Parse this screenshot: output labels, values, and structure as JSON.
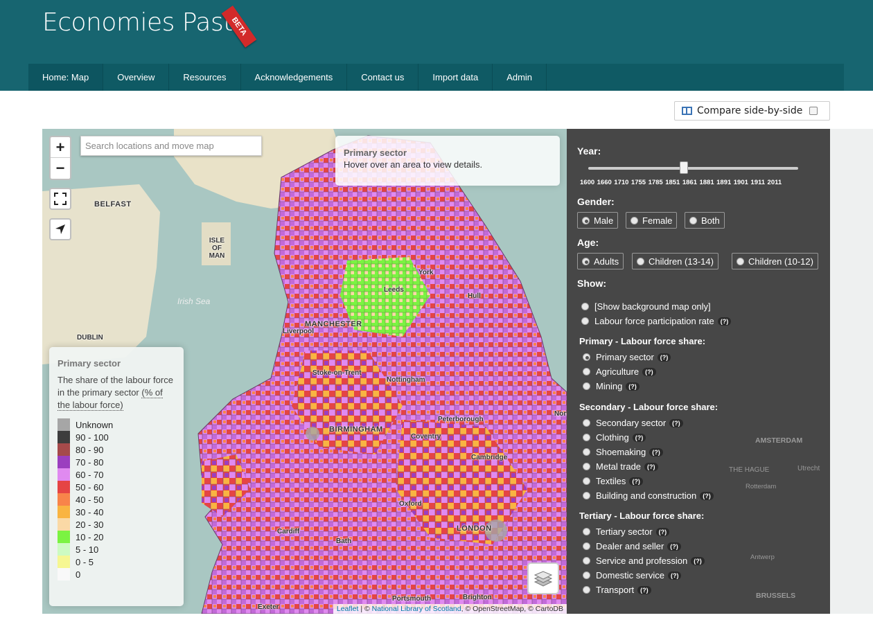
{
  "brand": {
    "title": "Economies Past",
    "badge": "BETA"
  },
  "nav": [
    "Home: Map",
    "Overview",
    "Resources",
    "Acknowledgements",
    "Contact us",
    "Import data",
    "Admin"
  ],
  "compare": {
    "label": "Compare side-by-side",
    "checked": false
  },
  "map": {
    "zoom_in": "+",
    "zoom_out": "−",
    "search_placeholder": "Search locations and move map",
    "info": {
      "title": "Primary sector",
      "text": "Hover over an area to view details."
    },
    "places": [
      "BELFAST",
      "ISLE OF MAN",
      "Irish Sea",
      "DUBLIN",
      "York",
      "Leeds",
      "Hull",
      "MANCHESTER",
      "Liverpool",
      "Stoke-on-Trent",
      "Nottingham",
      "Peterborough",
      "BIRMINGHAM",
      "Coventry",
      "Cambridge",
      "Oxford",
      "Cardiff",
      "Bath",
      "LONDON",
      "Portsmouth",
      "Brighton",
      "Exeter",
      "Norwich"
    ],
    "attribution": {
      "leaflet": "Leaflet",
      "nls": "National Library of Scotland",
      "rest": "© OpenStreetMap, © CartoDB"
    }
  },
  "legend": {
    "title": "Primary sector",
    "description": "The share of the labour force in the primary sector",
    "unit": "(% of the labour force)",
    "items": [
      {
        "label": "Unknown",
        "color": "#a6a6a6"
      },
      {
        "label": "90 - 100",
        "color": "#3d3d3d"
      },
      {
        "label": "80 - 90",
        "color": "#a54a4a"
      },
      {
        "label": "70 - 80",
        "color": "#9b3fbf"
      },
      {
        "label": "60 - 70",
        "color": "#e08af0"
      },
      {
        "label": "50 - 60",
        "color": "#e54444"
      },
      {
        "label": "40 - 50",
        "color": "#f8844a"
      },
      {
        "label": "30 - 40",
        "color": "#f9b442"
      },
      {
        "label": "20 - 30",
        "color": "#fad9a6"
      },
      {
        "label": "10 - 20",
        "color": "#7bf342"
      },
      {
        "label": "5 - 10",
        "color": "#cdfbc2"
      },
      {
        "label": "0 - 5",
        "color": "#f6f792"
      },
      {
        "label": "0",
        "color": "#f9f9f9"
      }
    ]
  },
  "panel": {
    "year_label": "Year:",
    "years": [
      "1600",
      "1660",
      "1710",
      "1755",
      "1785",
      "1851",
      "1861",
      "1881",
      "1891",
      "1901",
      "1911",
      "2011"
    ],
    "year_selected": "1851",
    "gender_label": "Gender:",
    "genders": [
      "Male",
      "Female",
      "Both"
    ],
    "age_label": "Age:",
    "ages": [
      "Adults",
      "Children (13-14)",
      "Children (10-12)"
    ],
    "show_label": "Show:",
    "show_options": [
      "[Show background map only]",
      "Labour force participation rate"
    ],
    "primary_heading": "Primary - Labour force share:",
    "primary": [
      "Primary sector",
      "Agriculture",
      "Mining"
    ],
    "secondary_heading": "Secondary - Labour force share:",
    "secondary": [
      "Secondary sector",
      "Clothing",
      "Shoemaking",
      "Metal trade",
      "Textiles",
      "Building and construction"
    ],
    "tertiary_heading": "Tertiary - Labour force share:",
    "tertiary": [
      "Tertiary sector",
      "Dealer and seller",
      "Service and profession",
      "Domestic service",
      "Transport"
    ],
    "help": "(?)"
  },
  "ext_labels": [
    "AMSTERDAM",
    "THE HAGUE",
    "Utrecht",
    "Rotterdam",
    "Antwerp",
    "BRUSSELS"
  ]
}
